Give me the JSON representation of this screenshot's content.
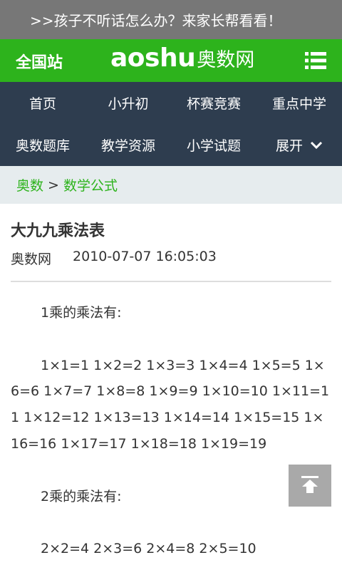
{
  "promo": {
    "text": ">>孩子不听话怎么办？来家长帮看看！"
  },
  "header": {
    "station": "全国站",
    "logo_latin": "aoshu",
    "logo_cn": "奥数网",
    "menu_icon": "list-icon"
  },
  "nav": {
    "items": [
      {
        "label": "首页"
      },
      {
        "label": "小升初"
      },
      {
        "label": "杯赛竞赛"
      },
      {
        "label": "重点中学"
      },
      {
        "label": "奥数题库"
      },
      {
        "label": "教学资源"
      },
      {
        "label": "小学试题"
      },
      {
        "label": "展开"
      }
    ],
    "expand_icon": "chevron-down-icon"
  },
  "breadcrumb": {
    "root": "奥数",
    "separator": ">",
    "current": "数学公式"
  },
  "article": {
    "title": "大九九乘法表",
    "source": "奥数网",
    "date": "2010-07-07 16:05:03",
    "section1_heading": "1乘的乘法有:",
    "section1_body": "1×1=1 1×2=2 1×3=3 1×4=4 1×5=5 1×6=6 1×7=7 1×8=8 1×9=9 1×10=10 1×11=11 1×12=12 1×13=13 1×14=14 1×15=15 1×16=16 1×17=17 1×18=18 1×19=19",
    "section2_heading": "2乘的乘法有:",
    "section2_body": "2×2=4 2×3=6 2×4=8 2×5=10"
  },
  "scroll_top": {
    "icon": "back-to-top-icon"
  },
  "colors": {
    "brand_green": "#2db31c",
    "nav_bg": "#2e3d4f",
    "promo_bg": "#777777",
    "breadcrumb_bg": "#e6ecee"
  }
}
